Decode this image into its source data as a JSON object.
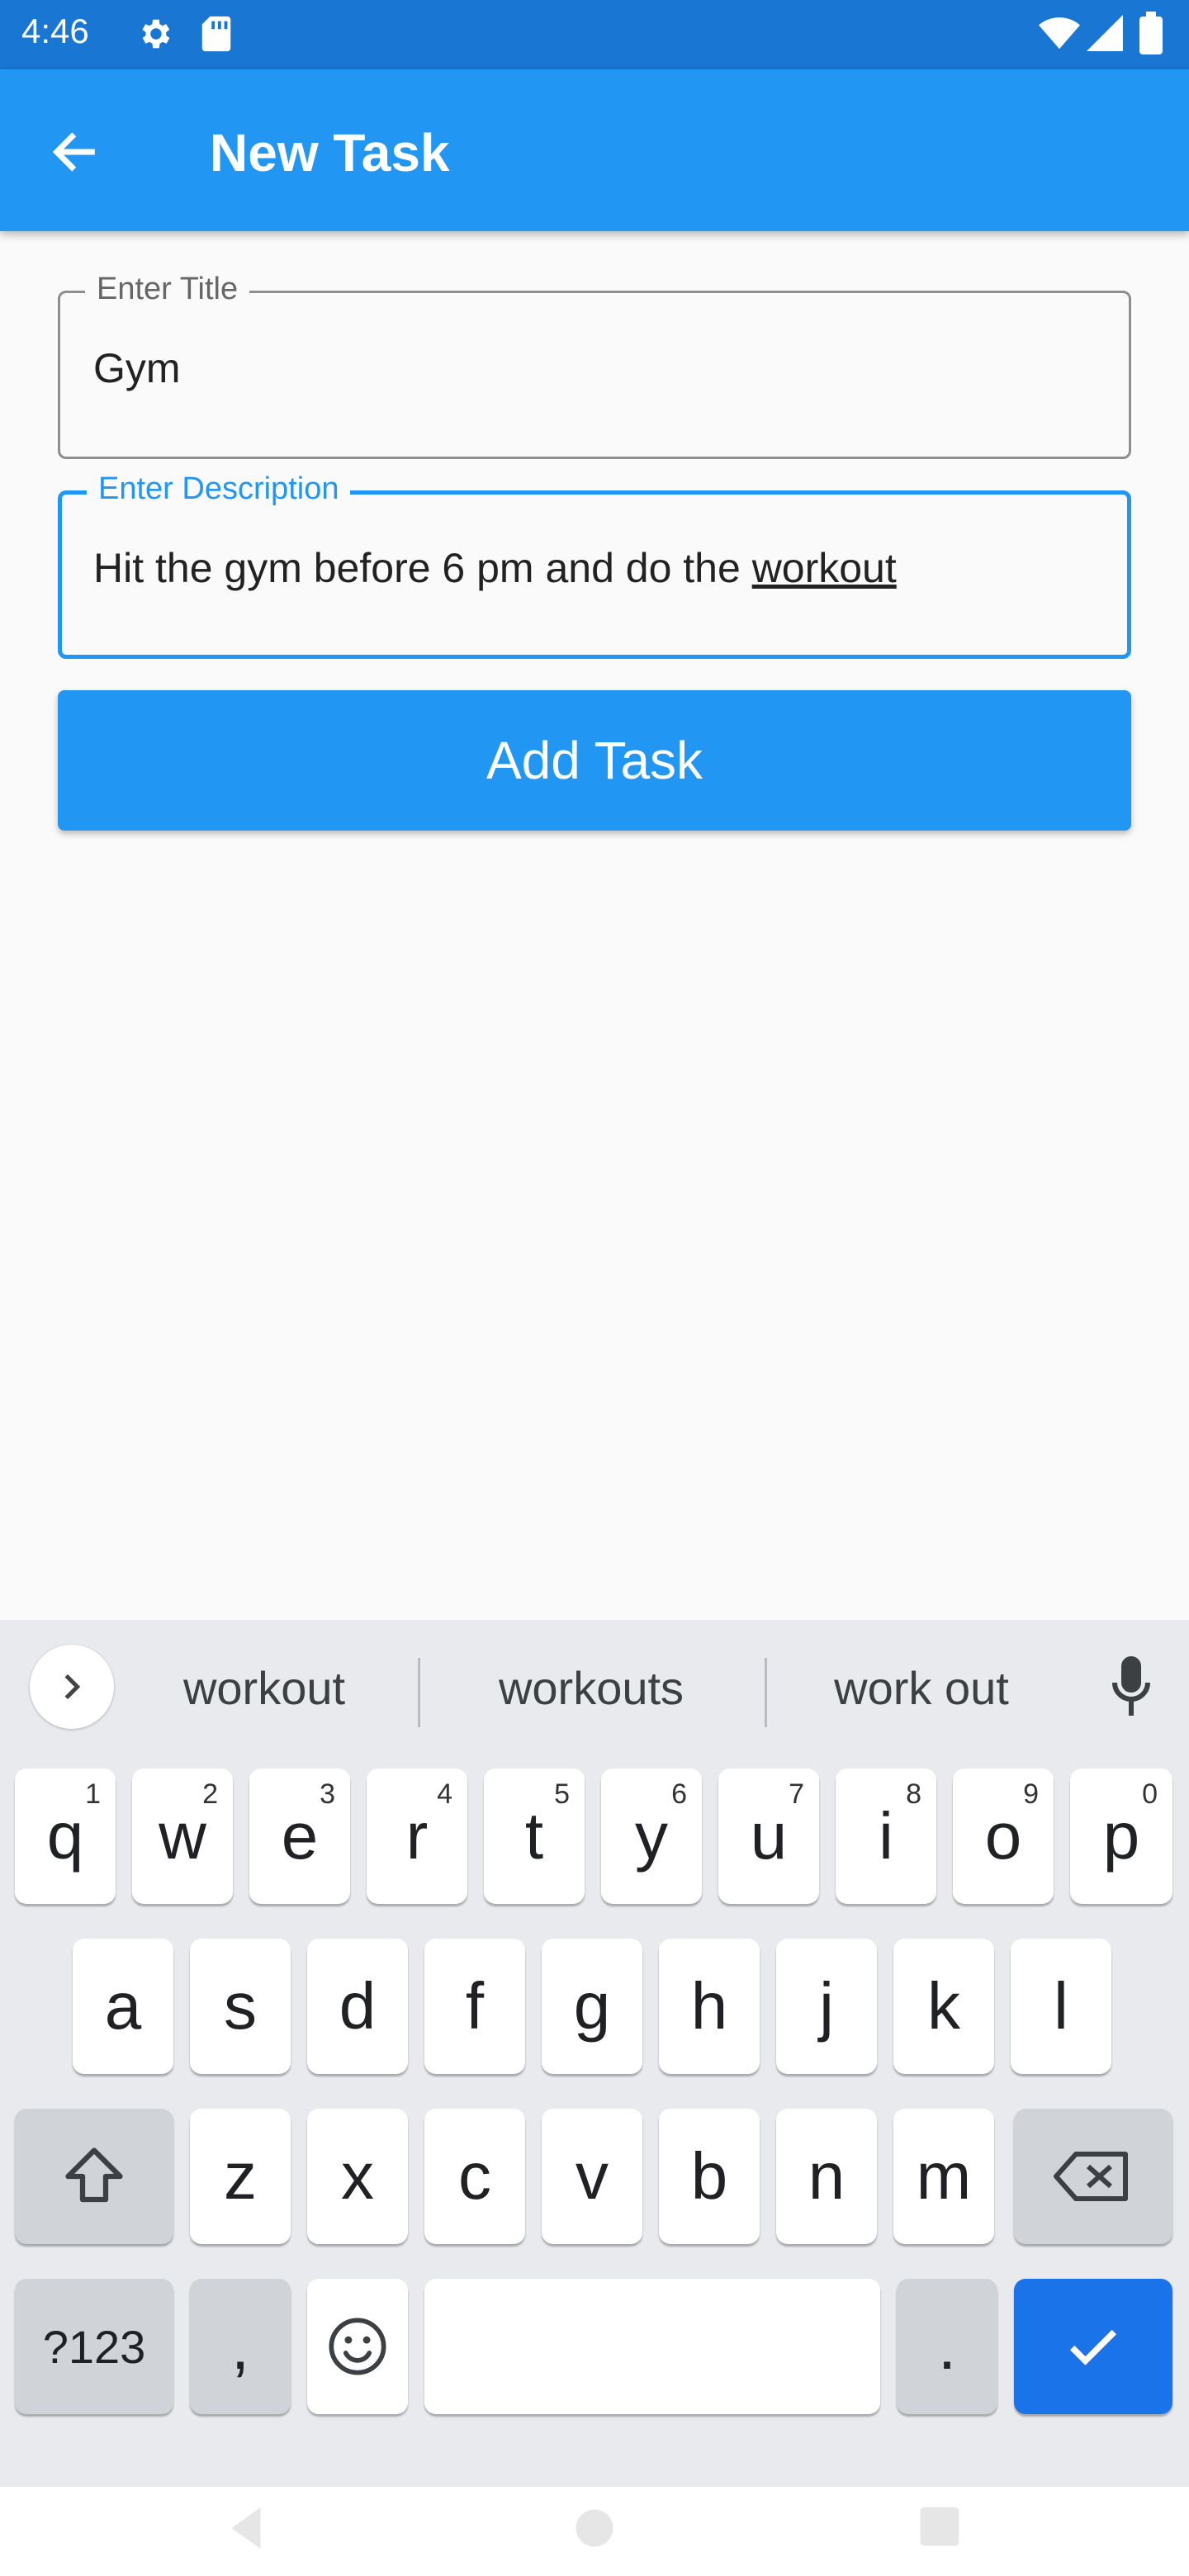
{
  "status_bar": {
    "time": "4:46"
  },
  "app_bar": {
    "title": "New Task"
  },
  "form": {
    "title_field": {
      "label": "Enter Title",
      "value": "Gym"
    },
    "description_field": {
      "label": "Enter Description",
      "value_prefix": "Hit the gym before 6 pm and do the ",
      "value_underlined": "workout"
    },
    "submit_label": "Add Task"
  },
  "keyboard": {
    "suggestions": [
      "workout",
      "workouts",
      "work out"
    ],
    "row1": [
      {
        "key": "q",
        "hint": "1"
      },
      {
        "key": "w",
        "hint": "2"
      },
      {
        "key": "e",
        "hint": "3"
      },
      {
        "key": "r",
        "hint": "4"
      },
      {
        "key": "t",
        "hint": "5"
      },
      {
        "key": "y",
        "hint": "6"
      },
      {
        "key": "u",
        "hint": "7"
      },
      {
        "key": "i",
        "hint": "8"
      },
      {
        "key": "o",
        "hint": "9"
      },
      {
        "key": "p",
        "hint": "0"
      }
    ],
    "row2": [
      "a",
      "s",
      "d",
      "f",
      "g",
      "h",
      "j",
      "k",
      "l"
    ],
    "row3": [
      "z",
      "x",
      "c",
      "v",
      "b",
      "n",
      "m"
    ],
    "symbols_label": "?123",
    "comma": ",",
    "period": "."
  },
  "colors": {
    "primary": "#2196f3",
    "status_bar": "#1976d2",
    "keyboard_action": "#1a73e8"
  }
}
